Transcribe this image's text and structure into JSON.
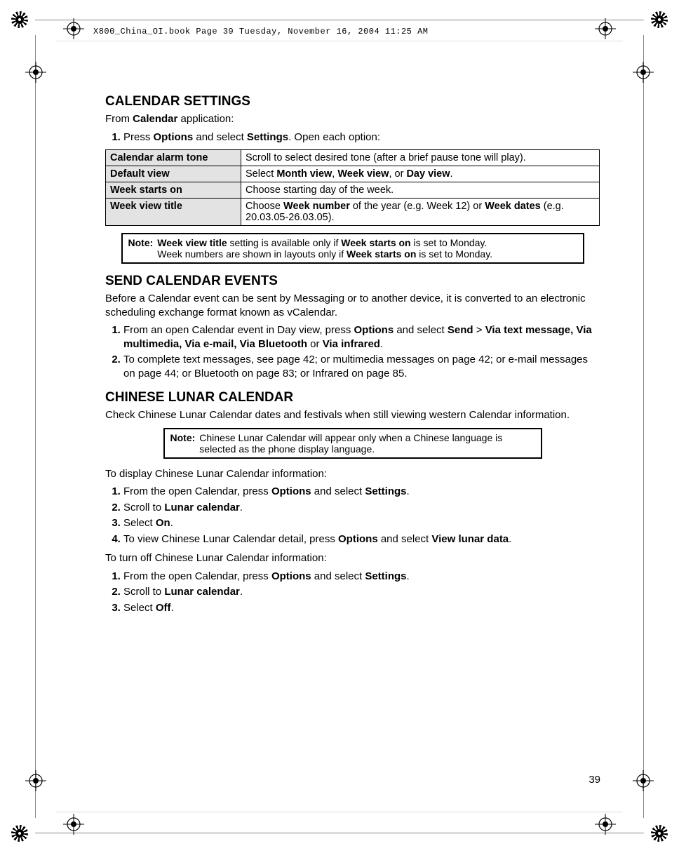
{
  "header": "X800_China_OI.book  Page 39  Tuesday, November 16, 2004  11:25 AM",
  "page_number": "39",
  "sections": {
    "calendar_settings": {
      "title": "CALENDAR SETTINGS",
      "intro_pre": "From ",
      "intro_bold": "Calendar",
      "intro_post": " application:",
      "step1_pre": "Press ",
      "step1_b1": "Options",
      "step1_mid": " and select ",
      "step1_b2": "Settings",
      "step1_post": ". Open each option:",
      "table": [
        {
          "label": "Calendar alarm tone",
          "desc_pre": "Scroll to select desired tone (after a brief pause tone will play).",
          "desc_b1": "",
          "desc_mid": "",
          "desc_b2": "",
          "desc_mid2": "",
          "desc_b3": "",
          "desc_post": ""
        },
        {
          "label": "Default view",
          "desc_pre": "Select ",
          "desc_b1": "Month view",
          "desc_mid": ", ",
          "desc_b2": "Week view",
          "desc_mid2": ", or ",
          "desc_b3": "Day view",
          "desc_post": "."
        },
        {
          "label": "Week starts on",
          "desc_pre": "Choose starting day of the week.",
          "desc_b1": "",
          "desc_mid": "",
          "desc_b2": "",
          "desc_mid2": "",
          "desc_b3": "",
          "desc_post": ""
        },
        {
          "label": "Week view title",
          "desc_pre": "Choose ",
          "desc_b1": "Week number",
          "desc_mid": " of the year (e.g. Week 12) or ",
          "desc_b2": "Week dates",
          "desc_mid2": " (e.g. 20.03.05-26.03.05).",
          "desc_b3": "",
          "desc_post": ""
        }
      ],
      "note": {
        "label": "Note:",
        "line1_b1": "Week view title",
        "line1_mid": " setting is available only if ",
        "line1_b2": "Week starts on",
        "line1_post": " is set to Monday.",
        "line2_pre": "Week numbers are shown in layouts only if ",
        "line2_b": "Week starts on",
        "line2_post": " is set to Monday."
      }
    },
    "send_events": {
      "title": "SEND CALENDAR EVENTS",
      "intro": "Before a Calendar event can be sent by Messaging or to another device, it is converted to an electronic scheduling exchange format known as vCalendar.",
      "step1_pre": "From an open Calendar event in Day view, press ",
      "step1_b1": "Options",
      "step1_mid1": " and select ",
      "step1_b2": "Send",
      "step1_mid2": " > ",
      "step1_b3": "Via text message, Via multimedia, Via e-mail, Via Bluetooth",
      "step1_mid3": " or ",
      "step1_b4": "Via infrared",
      "step1_post": ".",
      "step2": "To complete text messages, see page 42; or multimedia messages on page 42; or e-mail messages on page 44; or Bluetooth on page 83; or Infrared on page 85."
    },
    "lunar": {
      "title": "CHINESE LUNAR CALENDAR",
      "intro": "Check Chinese Lunar Calendar dates and festivals when still viewing western Calendar information.",
      "note": {
        "label": "Note:",
        "text": "Chinese Lunar Calendar will appear only when a Chinese language is selected as the phone display language."
      },
      "display_intro": "To display Chinese Lunar Calendar information:",
      "display_steps": {
        "s1_pre": "From the open Calendar, press ",
        "s1_b1": "Options",
        "s1_mid": " and select ",
        "s1_b2": "Settings",
        "s1_post": ".",
        "s2_pre": "Scroll to ",
        "s2_b": "Lunar calendar",
        "s2_post": ".",
        "s3_pre": "Select ",
        "s3_b": "On",
        "s3_post": ".",
        "s4_pre": "To view Chinese Lunar Calendar detail, press ",
        "s4_b1": "Options",
        "s4_mid": " and select ",
        "s4_b2": "View lunar data",
        "s4_post": "."
      },
      "off_intro": "To turn off Chinese Lunar Calendar information:",
      "off_steps": {
        "s1_pre": "From the open Calendar, press ",
        "s1_b1": "Options",
        "s1_mid": " and select ",
        "s1_b2": "Settings",
        "s1_post": ".",
        "s2_pre": "Scroll to ",
        "s2_b": "Lunar calendar",
        "s2_post": ".",
        "s3_pre": "Select ",
        "s3_b": "Off",
        "s3_post": "."
      }
    }
  }
}
